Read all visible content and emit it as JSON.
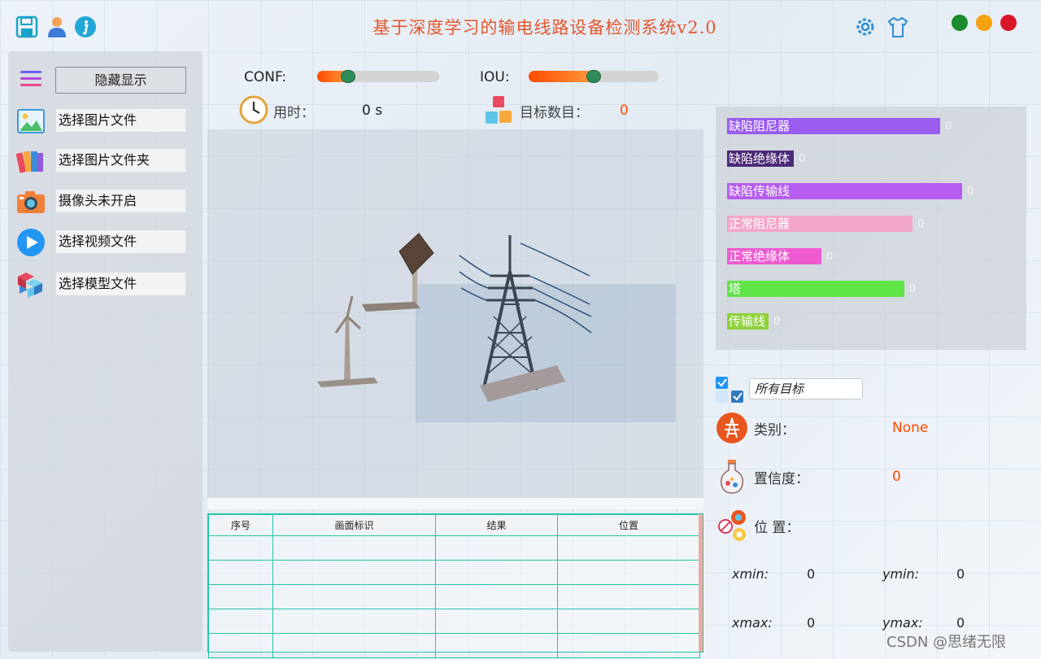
{
  "window": {
    "title": "基于深度学习的输电线路设备检测系统v2.0",
    "title_color": "#e4572e",
    "window_controls": [
      {
        "name": "close-control",
        "color": "#1c8a2e"
      },
      {
        "name": "minimize-control",
        "color": "#f5a20f"
      },
      {
        "name": "maximize-control",
        "color": "#d9152a"
      }
    ],
    "icons": [
      "save-icon",
      "user-icon",
      "info-icon",
      "settings-icon",
      "theme-shirt-icon"
    ]
  },
  "sidebar": {
    "toggle_label": "隐藏显示",
    "items": [
      {
        "label": "选择图片文件",
        "icon": "image-file-icon"
      },
      {
        "label": "选择图片文件夹",
        "icon": "image-folder-icon"
      },
      {
        "label": "摄像头未开启",
        "icon": "camera-icon"
      },
      {
        "label": "选择视频文件",
        "icon": "play-video-icon"
      },
      {
        "label": "选择模型文件",
        "icon": "model-cubes-icon"
      }
    ]
  },
  "controls": {
    "conf_label": "CONF:",
    "conf_value": 0.25,
    "iou_label": "IOU:",
    "iou_value": 0.5,
    "time_label": "用时：",
    "time_value": "0 s",
    "count_label": "目标数目：",
    "count_value": "0"
  },
  "results_table": {
    "columns": [
      "序号",
      "画面标识",
      "结果",
      "位置"
    ],
    "rows": [
      [
        "",
        "",
        "",
        ""
      ],
      [
        "",
        "",
        "",
        ""
      ],
      [
        "",
        "",
        "",
        ""
      ],
      [
        "",
        "",
        "",
        ""
      ],
      [
        "",
        "",
        "",
        ""
      ]
    ]
  },
  "class_stats": [
    {
      "label": "缺陷阻尼器",
      "count": "0",
      "color": "#9b5cf0",
      "level": 0.77
    },
    {
      "label": "缺陷绝缘体",
      "count": "0",
      "color": "#4b2a78",
      "level": 0.24
    },
    {
      "label": "缺陷传输线",
      "count": "0",
      "color": "#b65cef",
      "level": 0.85
    },
    {
      "label": "正常阻尼器",
      "count": "0",
      "color": "#f4a6c8",
      "level": 0.67
    },
    {
      "label": "正常绝缘体",
      "count": "0",
      "color": "#ee5bd0",
      "level": 0.34
    },
    {
      "label": "塔",
      "count": "0",
      "color": "#5fe548",
      "level": 0.64
    },
    {
      "label": "传输线",
      "count": "0",
      "color": "#8ed13a",
      "level": 0.15
    }
  ],
  "details": {
    "target_select": "所有目标",
    "class_label": "类别：",
    "class_value": "None",
    "confidence_label": "置信度：",
    "confidence_value": "0",
    "position_label": "位 置：",
    "xmin_label": "xmin:",
    "xmin_value": "0",
    "ymin_label": "ymin:",
    "ymin_value": "0",
    "xmax_label": "xmax:",
    "xmax_value": "0",
    "ymax_label": "ymax:",
    "ymax_value": "0"
  },
  "watermark": "CSDN @思绪无限"
}
